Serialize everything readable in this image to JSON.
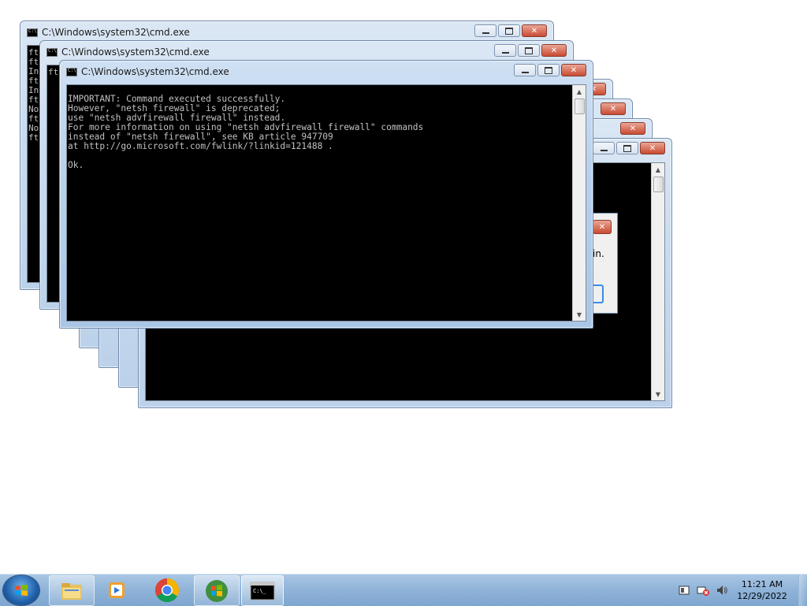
{
  "windows": {
    "title": "C:\\Windows\\system32\\cmd.exe",
    "back_left_column": [
      "ft",
      "ft",
      "In",
      "ft",
      "In",
      "ft",
      "No",
      "ft",
      "No",
      "ft"
    ],
    "second_left_column": [
      "ft"
    ],
    "front_console_text": "IMPORTANT: Command executed successfully.\nHowever, \"netsh firewall\" is deprecated;\nuse \"netsh advfirewall firewall\" instead.\nFor more information on using \"netsh advfirewall firewall\" commands\ninstead of \"netsh firewall\", see KB article 947709\nat http://go.microsoft.com/fwlink/?linkid=121488 .\n\nOk."
  },
  "dialog": {
    "partial_text": "in."
  },
  "taskbar": {
    "pinned": [
      "start-button",
      "explorer",
      "media-player",
      "chrome",
      "windows-live",
      "cmd"
    ],
    "clock_time": "11:21 AM",
    "clock_date": "12/29/2022"
  },
  "colors": {
    "console_bg": "#000000",
    "console_fg": "#c0c0c0",
    "taskbar": "#8fb3d8"
  }
}
